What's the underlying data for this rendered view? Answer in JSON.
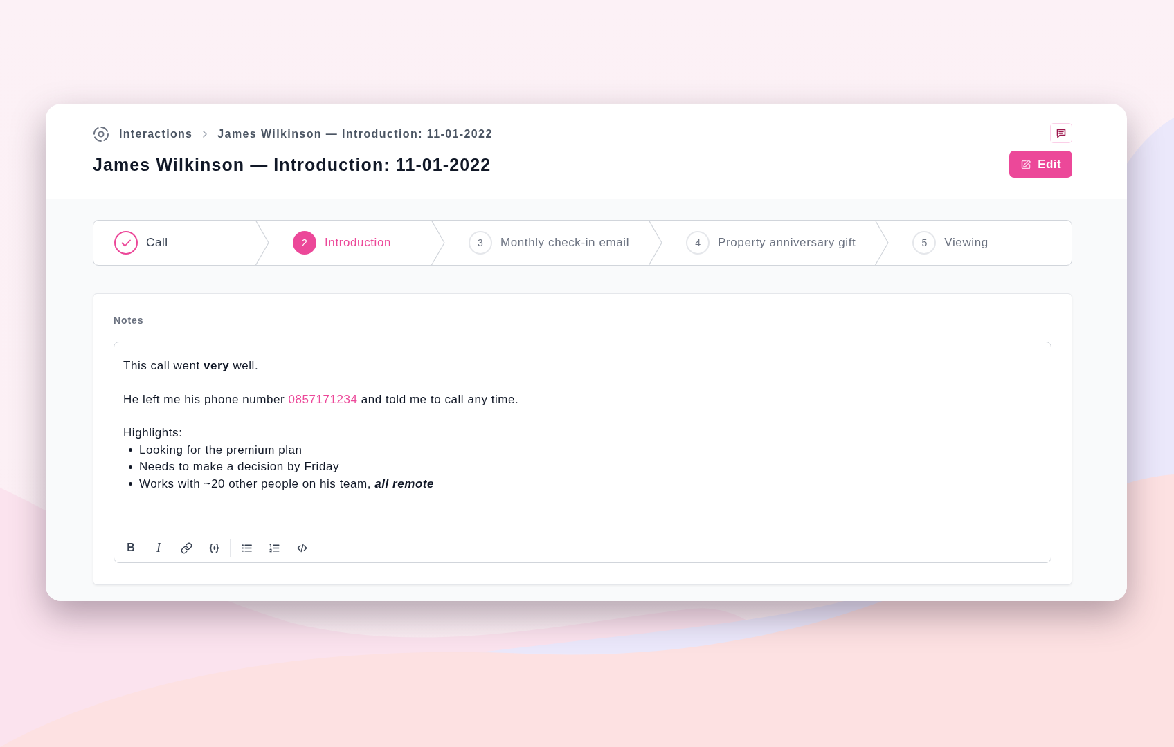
{
  "breadcrumb": [
    {
      "label": "Interactions"
    },
    {
      "label": "James Wilkinson — Introduction: 11-01-2022"
    }
  ],
  "title": "James Wilkinson — Introduction: 11-01-2022",
  "edit_button": {
    "label": "Edit"
  },
  "steps": [
    {
      "label": "Call",
      "completed": true,
      "selected": false
    },
    {
      "number": "2",
      "label": "Introduction",
      "completed": false,
      "selected": true
    },
    {
      "number": "3",
      "label": "Monthly check-in email",
      "completed": false,
      "selected": false
    },
    {
      "number": "4",
      "label": "Property anniversary gift",
      "completed": false,
      "selected": false
    },
    {
      "number": "5",
      "label": "Viewing",
      "completed": false,
      "selected": false
    }
  ],
  "notes": {
    "label": "Notes",
    "content": [
      {
        "kind": "paragraph",
        "text": "This call went **very** well."
      },
      {
        "kind": "paragraph_with_link",
        "before": "He left me his phone number",
        "link": "0857171234",
        "after": "and told me to call any time."
      },
      {
        "kind": "list",
        "intro": "Highlights:",
        "items": [
          "Looking for the premium plan",
          "Needs to make a decision by Friday",
          "Works with ~20 other people on his team, *all remote*"
        ]
      }
    ],
    "toolbar": [
      {
        "items": [
          {
            "kind": "bold",
            "label": "B"
          },
          {
            "kind": "italic",
            "label": "I"
          },
          {
            "kind": "link"
          },
          {
            "kind": "variable"
          }
        ]
      },
      {
        "items": [
          {
            "kind": "bullet_list"
          },
          {
            "kind": "numbered_list"
          },
          {
            "kind": "code"
          }
        ]
      }
    ]
  }
}
